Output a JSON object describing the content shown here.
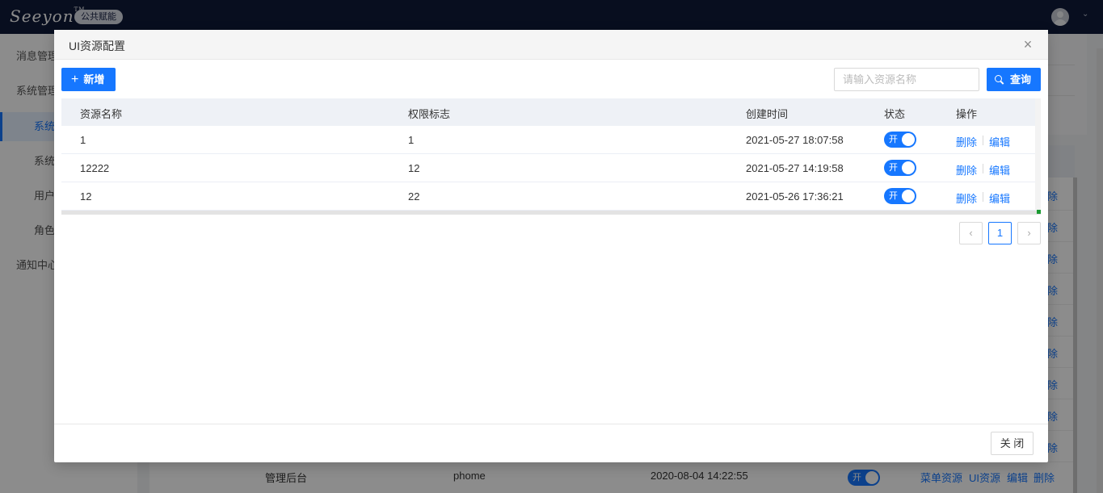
{
  "topbar": {
    "logo_text": "Seeyon",
    "logo_tm": "TM",
    "badge": "公共赋能",
    "avatar_icon": "user-avatar-icon",
    "caret": "⌄"
  },
  "sidebar": {
    "items": [
      {
        "label": "消息管理"
      },
      {
        "label": "系统管理"
      },
      {
        "label": "系统"
      },
      {
        "label": "系统"
      },
      {
        "label": "用户"
      },
      {
        "label": "角色"
      },
      {
        "label": "通知中心"
      }
    ]
  },
  "background": {
    "fragment": "除",
    "last_row": {
      "name": "管理后台",
      "code": "phome",
      "time": "2020-08-04 14:22:55",
      "status": "开",
      "actions": [
        "菜单资源",
        "UI资源",
        "编辑",
        "删除"
      ]
    }
  },
  "modal": {
    "title": "UI资源配置",
    "close_icon": "×",
    "add_button": "新增",
    "add_icon": "+",
    "search": {
      "placeholder": "请输入资源名称",
      "value": "",
      "button": "查询"
    },
    "table": {
      "columns": [
        "资源名称",
        "权限标志",
        "创建时间",
        "状态",
        "操作"
      ],
      "rows": [
        {
          "name": "1",
          "code": "1",
          "time": "2021-05-27 18:07:58",
          "status": "开",
          "delete": "删除",
          "edit": "编辑"
        },
        {
          "name": "12222",
          "code": "12",
          "time": "2021-05-27 14:19:58",
          "status": "开",
          "delete": "删除",
          "edit": "编辑"
        },
        {
          "name": "12",
          "code": "22",
          "time": "2021-05-26 17:36:21",
          "status": "开",
          "delete": "删除",
          "edit": "编辑"
        }
      ]
    },
    "pagination": {
      "prev": "‹",
      "current": "1",
      "next": "›"
    },
    "footer_close": "关 闭"
  },
  "colors": {
    "primary": "#1677ff",
    "topbar": "#0f1a3a"
  }
}
